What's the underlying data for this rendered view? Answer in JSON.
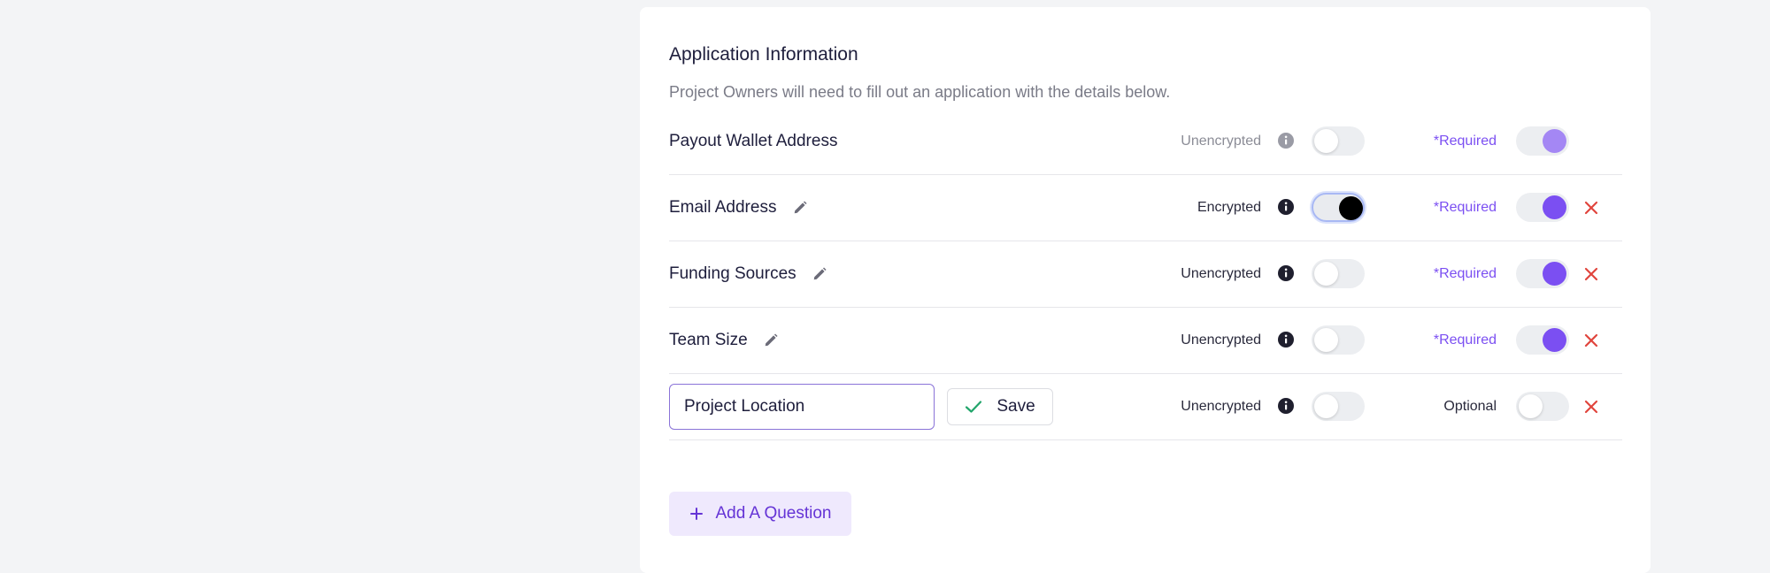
{
  "section": {
    "title": "Application Information",
    "subtitle": "Project Owners will need to fill out an application with the details below."
  },
  "questions": [
    {
      "label": "Payout Wallet Address",
      "editable": false,
      "encryption_label": "Unencrypted",
      "encrypted": false,
      "requirement_label": "*Required",
      "required": true,
      "removable": false
    },
    {
      "label": "Email Address",
      "editable": true,
      "encryption_label": "Encrypted",
      "encrypted": true,
      "requirement_label": "*Required",
      "required": true,
      "removable": true
    },
    {
      "label": "Funding Sources",
      "editable": true,
      "encryption_label": "Unencrypted",
      "encrypted": false,
      "requirement_label": "*Required",
      "required": true,
      "removable": true
    },
    {
      "label": "Team Size",
      "editable": true,
      "encryption_label": "Unencrypted",
      "encrypted": false,
      "requirement_label": "*Required",
      "required": true,
      "removable": true
    },
    {
      "label": "Project Location",
      "editing": true,
      "encryption_label": "Unencrypted",
      "encrypted": false,
      "requirement_label": "Optional",
      "required": false,
      "removable": true
    }
  ],
  "editor": {
    "input_value": "Project Location",
    "save_label": "Save"
  },
  "add_question_label": "Add A Question",
  "icons": {
    "edit": "pencil-icon",
    "info": "info-icon",
    "remove": "close-icon",
    "save": "check-icon",
    "add": "plus-icon"
  },
  "colors": {
    "accent": "#7b4ff2",
    "remove": "#e0453d",
    "save_check": "#22a56b",
    "add_bg": "#efe9fd"
  }
}
